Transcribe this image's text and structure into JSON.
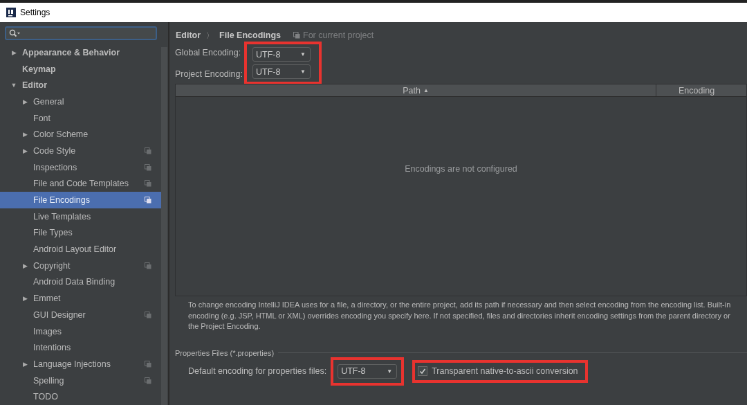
{
  "window": {
    "title": "Settings"
  },
  "sidebar": {
    "items": [
      {
        "label": "Appearance & Behavior",
        "arrow": "▶",
        "selected": false,
        "project_scoped": false
      },
      {
        "label": "Keymap",
        "selected": false,
        "project_scoped": false
      },
      {
        "label": "Editor",
        "arrow": "▼",
        "selected": false,
        "project_scoped": false,
        "children": [
          {
            "label": "General",
            "arrow": "▶",
            "selected": false,
            "project_scoped": false
          },
          {
            "label": "Font",
            "selected": false,
            "project_scoped": false
          },
          {
            "label": "Color Scheme",
            "arrow": "▶",
            "selected": false,
            "project_scoped": false
          },
          {
            "label": "Code Style",
            "arrow": "▶",
            "selected": false,
            "project_scoped": true
          },
          {
            "label": "Inspections",
            "selected": false,
            "project_scoped": true
          },
          {
            "label": "File and Code Templates",
            "selected": false,
            "project_scoped": true
          },
          {
            "label": "File Encodings",
            "selected": true,
            "project_scoped": true
          },
          {
            "label": "Live Templates",
            "selected": false,
            "project_scoped": false
          },
          {
            "label": "File Types",
            "selected": false,
            "project_scoped": false
          },
          {
            "label": "Android Layout Editor",
            "selected": false,
            "project_scoped": false
          },
          {
            "label": "Copyright",
            "arrow": "▶",
            "selected": false,
            "project_scoped": true
          },
          {
            "label": "Android Data Binding",
            "selected": false,
            "project_scoped": false
          },
          {
            "label": "Emmet",
            "arrow": "▶",
            "selected": false,
            "project_scoped": false
          },
          {
            "label": "GUI Designer",
            "selected": false,
            "project_scoped": true
          },
          {
            "label": "Images",
            "selected": false,
            "project_scoped": false
          },
          {
            "label": "Intentions",
            "selected": false,
            "project_scoped": false
          },
          {
            "label": "Language Injections",
            "arrow": "▶",
            "selected": false,
            "project_scoped": true
          },
          {
            "label": "Spelling",
            "selected": false,
            "project_scoped": true
          },
          {
            "label": "TODO",
            "selected": false,
            "project_scoped": false
          }
        ]
      }
    ]
  },
  "breadcrumb": {
    "parts": [
      "Editor",
      "File Encodings"
    ],
    "separator": "〉",
    "scope": "For current project"
  },
  "encodings": {
    "highlighted": true,
    "rows": [
      {
        "label": "Global Encoding:",
        "value": "UTF-8",
        "arrow": "▼"
      },
      {
        "label": "Project Encoding:",
        "value": "UTF-8",
        "arrow": "▼"
      }
    ]
  },
  "table": {
    "columns": [
      {
        "label": "Path",
        "sort": "▲"
      },
      {
        "label": "Encoding"
      }
    ],
    "empty_text": "Encodings are not configured"
  },
  "description": "To change encoding IntelliJ IDEA uses for a file, a directory, or the entire project, add its path if necessary and then select encoding from the encoding list. Built-in\nencoding (e.g. JSP, HTML or XML) overrides encoding you specify here. If not specified, files and directories inherit encoding settings from the parent directory or\nthe Project Encoding.",
  "properties": {
    "title": "Properties Files (*.properties)",
    "label": "Default encoding for properties files:",
    "value": "UTF-8",
    "arrow": "▼",
    "value_highlighted": true,
    "checkbox": {
      "label": "Transparent native-to-ascii conversion",
      "checked": true,
      "highlighted": true
    }
  }
}
